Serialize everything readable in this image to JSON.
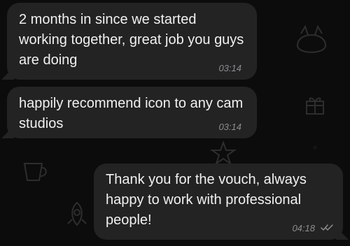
{
  "messages": [
    {
      "text": "2 months in since we started\nworking together, great job you guys\nare doing",
      "time": "03:14"
    },
    {
      "text": "happily recommend icon to any cam\nstudios",
      "time": "03:14"
    },
    {
      "text": "Thank you for the vouch, always\nhappy to work with professional\npeople!",
      "time": "04:18",
      "status_icon": "double-check-icon"
    }
  ],
  "colors": {
    "background": "#0c0c0c",
    "bubble": "#232324",
    "text": "#f1f1f1",
    "time": "#8d8d8f"
  }
}
